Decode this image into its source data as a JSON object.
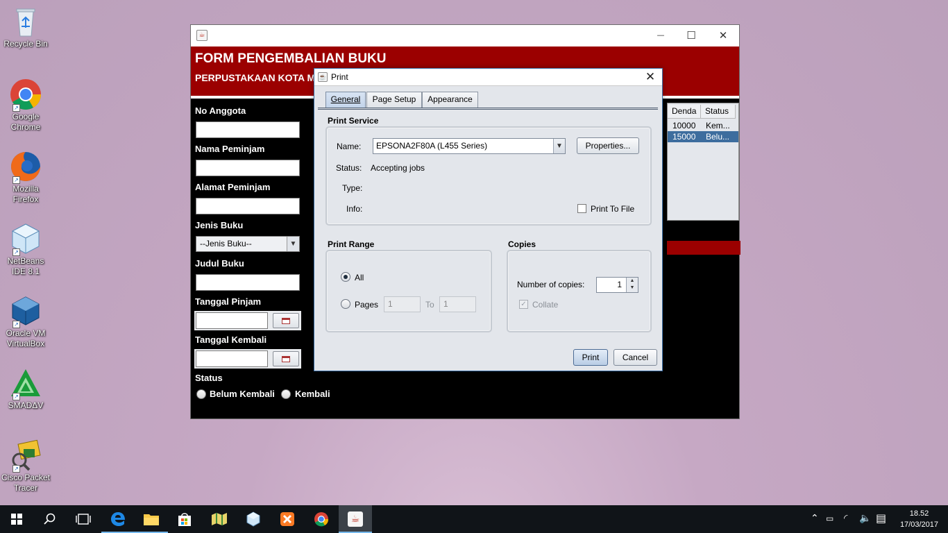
{
  "desktop": {
    "icons": [
      {
        "label": "Recycle Bin"
      },
      {
        "label": "Google Chrome"
      },
      {
        "label": "Mozilla Firefox"
      },
      {
        "label": "NetBeans IDE 8.1"
      },
      {
        "label": "Oracle VM VirtualBox"
      },
      {
        "label": "SMADΔV"
      },
      {
        "label": "Cisco Packet Tracer"
      }
    ]
  },
  "app": {
    "title": "FORM PENGEMBALIAN BUKU",
    "subtitle": "PERPUSTAKAAN KOTA M",
    "controls": {
      "minimize": "—",
      "maximize": "☐",
      "close": "✕"
    },
    "fields": {
      "no_anggota": "No Anggota",
      "nama_peminjam": "Nama Peminjam",
      "alamat_peminjam": "Alamat Peminjam",
      "jenis_buku": "Jenis Buku",
      "jenis_buku_selected": "--Jenis Buku--",
      "judul_buku": "Judul Buku",
      "tanggal_pinjam": "Tanggal Pinjam",
      "tanggal_kembali": "Tanggal Kembali",
      "status": "Status",
      "status_options": [
        "Belum Kembali",
        "Kembali"
      ]
    },
    "table": {
      "columns": [
        "Denda",
        "Status"
      ],
      "rows": [
        {
          "denda": "10000",
          "status": "Kem..."
        },
        {
          "denda": "15000",
          "status": "Belu..."
        }
      ],
      "selected_row_color": "#3d6d9e"
    },
    "header_color": "#9b0000"
  },
  "dialog": {
    "title": "Print",
    "close": "✕",
    "tabs": [
      {
        "label": "General",
        "active": true
      },
      {
        "label": "Page Setup",
        "active": false
      },
      {
        "label": "Appearance",
        "active": false
      }
    ],
    "print_service": {
      "section": "Print Service",
      "name_label": "Name:",
      "name_value": "EPSONA2F80A (L455 Series)",
      "properties_button": "Properties...",
      "status_label": "Status:",
      "status_value": "Accepting jobs",
      "type_label": "Type:",
      "info_label": "Info:",
      "print_to_file": "Print To File"
    },
    "print_range": {
      "section": "Print Range",
      "all": "All",
      "pages": "Pages",
      "from_value": "1",
      "to_label": "To",
      "to_value": "1"
    },
    "copies": {
      "section": "Copies",
      "number_label": "Number of copies:",
      "number_value": "1",
      "collate": "Collate"
    },
    "buttons": {
      "print": "Print",
      "cancel": "Cancel"
    }
  },
  "taskbar": {
    "clock_time": "18.52",
    "clock_date": "17/03/2017"
  }
}
